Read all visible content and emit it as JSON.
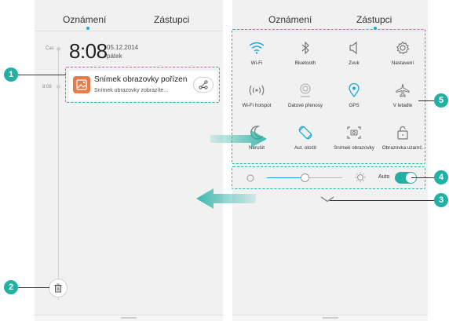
{
  "left_panel": {
    "tabs": [
      {
        "label": "Oznámení"
      },
      {
        "label": "Zástupci"
      }
    ],
    "timeline_label": "Čas",
    "time": "8:08",
    "date": "05.12.2014",
    "day": "pátek",
    "entry_time": "8:08",
    "notification": {
      "title": "Snímek obrazovky pořízen",
      "text": "Snímek obrazovky zobrazíte...",
      "icon": "image-icon",
      "action_icon": "share-icon"
    },
    "trash_icon": "trash-icon"
  },
  "right_panel": {
    "tabs": [
      {
        "label": "Oznámení"
      },
      {
        "label": "Zástupci"
      }
    ],
    "quick_settings": [
      {
        "label": "Wi-Fi",
        "icon": "wifi-icon",
        "active": true
      },
      {
        "label": "Bluetooth",
        "icon": "bluetooth-icon",
        "active": false
      },
      {
        "label": "Zvuk",
        "icon": "sound-icon",
        "active": false
      },
      {
        "label": "Nastavení",
        "icon": "gear-icon",
        "active": false
      },
      {
        "label": "Wi-Fi hotspot",
        "icon": "hotspot-icon",
        "active": false
      },
      {
        "label": "Datové přenosy",
        "icon": "data-icon",
        "active": false
      },
      {
        "label": "GPS",
        "icon": "gps-icon",
        "active": true
      },
      {
        "label": "V letadle",
        "icon": "airplane-icon",
        "active": false
      },
      {
        "label": "Nerušit",
        "icon": "moon-icon",
        "active": false
      },
      {
        "label": "Aut. otočit",
        "icon": "rotate-icon",
        "active": true
      },
      {
        "label": "Snímek obrazovky",
        "icon": "screenshot-icon",
        "active": false
      },
      {
        "label": "Obrazovka uzamč.",
        "icon": "lock-icon",
        "active": false
      }
    ],
    "brightness": {
      "value": 0.5,
      "auto_label": "Auto",
      "auto_on": true
    }
  },
  "callouts": [
    "1",
    "2",
    "3",
    "4",
    "5"
  ],
  "colors": {
    "accent": "#22b0a3",
    "active_icon": "#18a9e0",
    "notif_icon": "#e57c4a"
  }
}
